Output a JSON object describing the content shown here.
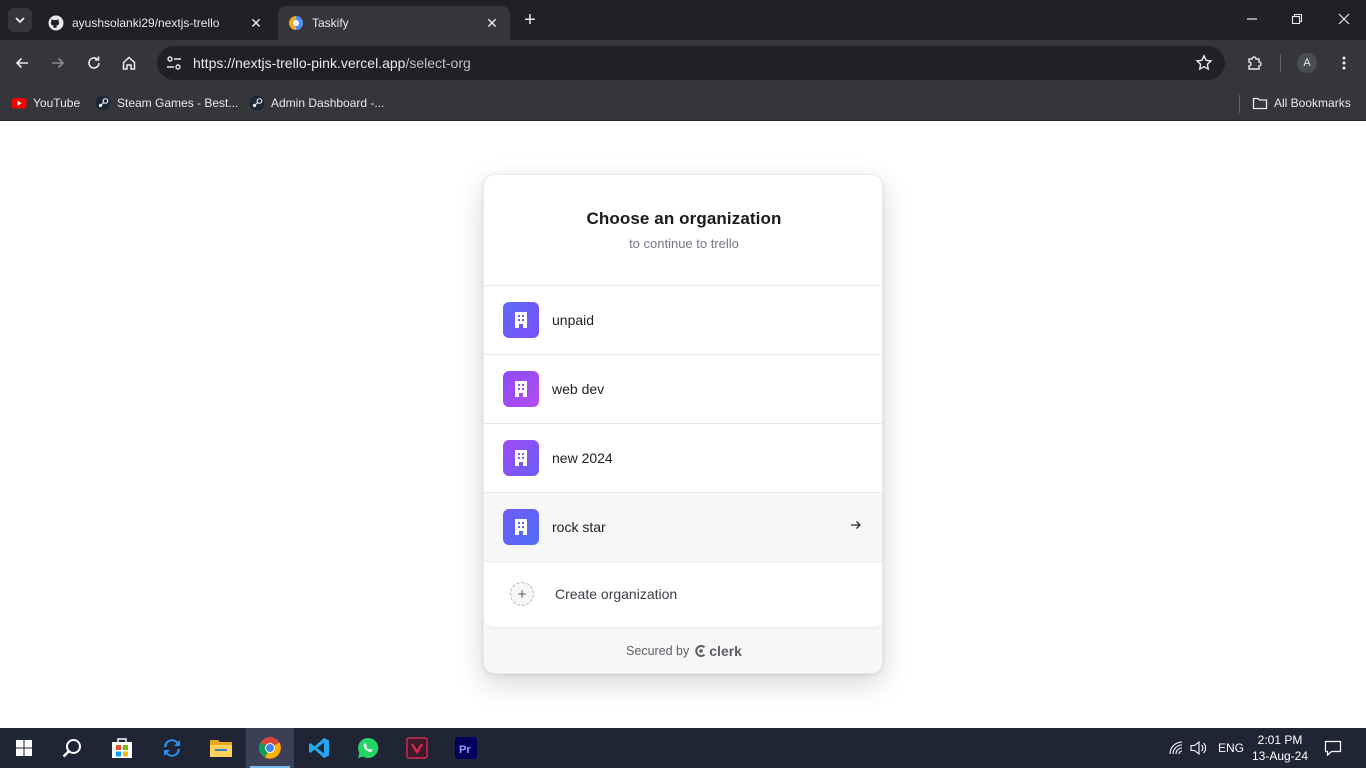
{
  "browser": {
    "tabs": [
      {
        "title": "ayushsolanki29/nextjs-trello",
        "favicon": "github-icon",
        "active": false
      },
      {
        "title": "Taskify",
        "favicon": "taskify-icon",
        "active": true
      }
    ],
    "url": {
      "host": "https://nextjs-trello-pink.vercel.app",
      "path": "/select-org"
    },
    "profile_initial": "A",
    "bookmarks": [
      {
        "label": "YouTube",
        "icon": "youtube-icon"
      },
      {
        "label": "Steam Games - Best...",
        "icon": "steam-icon"
      },
      {
        "label": "Admin Dashboard -...",
        "icon": "steam-icon"
      }
    ],
    "all_bookmarks_label": "All Bookmarks"
  },
  "org_picker": {
    "title": "Choose an organization",
    "subtitle": "to continue to trello",
    "organizations": [
      {
        "name": "unpaid",
        "color_from": "#5b6cf2",
        "color_to": "#7c4dff"
      },
      {
        "name": "web dev",
        "color_from": "#8a4cf7",
        "color_to": "#b44cf0"
      },
      {
        "name": "new 2024",
        "color_from": "#a04cf6",
        "color_to": "#6a5cf5"
      },
      {
        "name": "rock star",
        "color_from": "#6e5cf7",
        "color_to": "#4f6ef5"
      }
    ],
    "hovered_index": 3,
    "create_label": "Create organization",
    "footer_prefix": "Secured by",
    "footer_brand": "clerk"
  },
  "taskbar": {
    "apps": [
      "windows-start-icon",
      "search-icon",
      "store-icon",
      "sync-icon",
      "file-explorer-icon",
      "chrome-icon",
      "vscode-icon",
      "whatsapp-icon",
      "vivaldi-icon",
      "premiere-icon"
    ],
    "active_app": "chrome-icon",
    "language": "ENG",
    "time": "2:01 PM",
    "date": "13-Aug-24"
  }
}
